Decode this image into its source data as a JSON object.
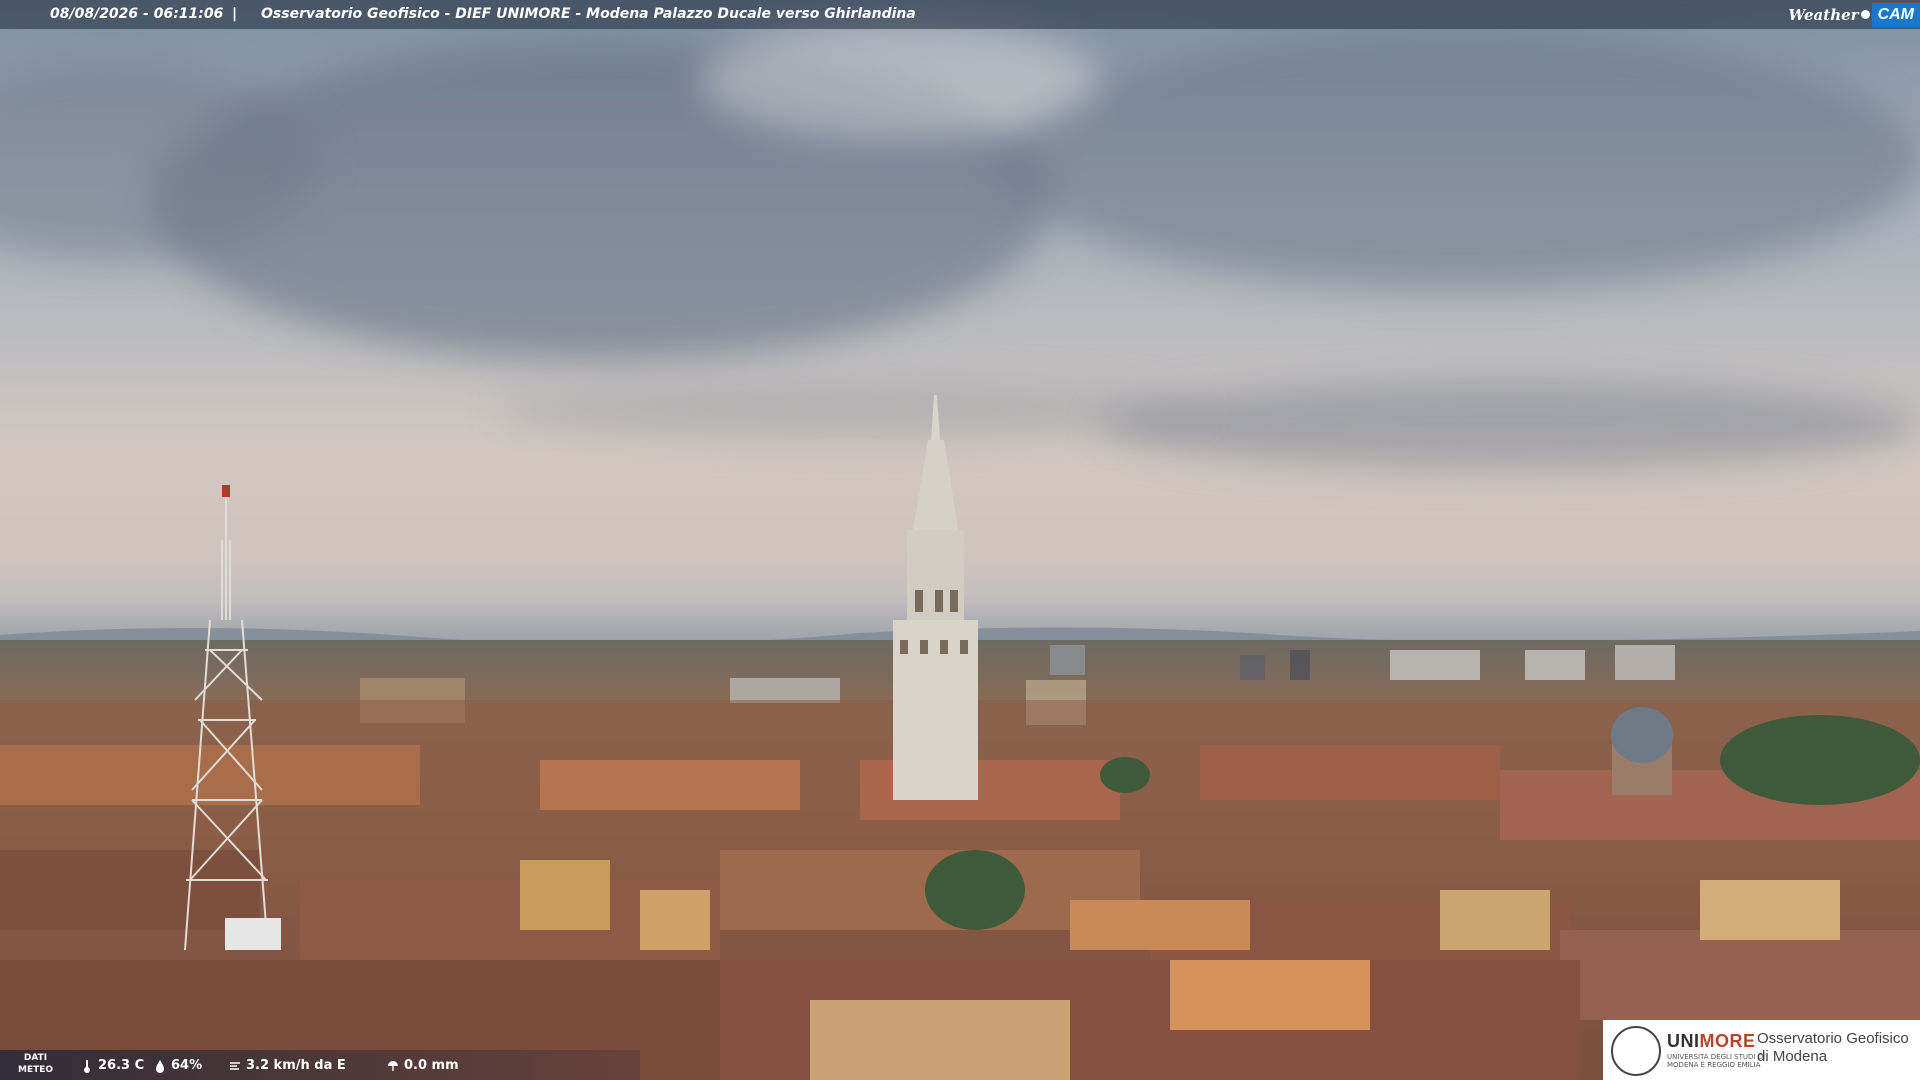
{
  "overlay": {
    "datetime": "08/08/2026 - 06:11:06",
    "separator": "|",
    "title": "Osservatorio Geofisico - DIEF UNIMORE - Modena Palazzo Ducale verso Ghirlandina",
    "brand_weather": "Weather",
    "brand_cam": "CAM"
  },
  "meteo": {
    "label_line1": "DATI",
    "label_line2": "METEO",
    "temperature": "26.3 C",
    "humidity": "64%",
    "wind": "3.2 km/h da E",
    "rain": "0.0 mm",
    "icons": [
      "thermometer-icon",
      "humidity-drop-icon",
      "wind-icon",
      "rain-icon"
    ]
  },
  "logo": {
    "uni_prefix": "UNI",
    "uni_suffix": "MORE",
    "uni_sub_line1": "UNIVERSITÀ DEGLI STUDI DI",
    "uni_sub_line2": "MODENA E REGGIO EMILIA",
    "obs_line1": "Osservatorio Geofisico",
    "obs_line2": "di Modena"
  },
  "colors": {
    "overlay_bar": "#1e283c",
    "brand_cam": "#1a77c9",
    "unimore_accent": "#b4462f"
  }
}
